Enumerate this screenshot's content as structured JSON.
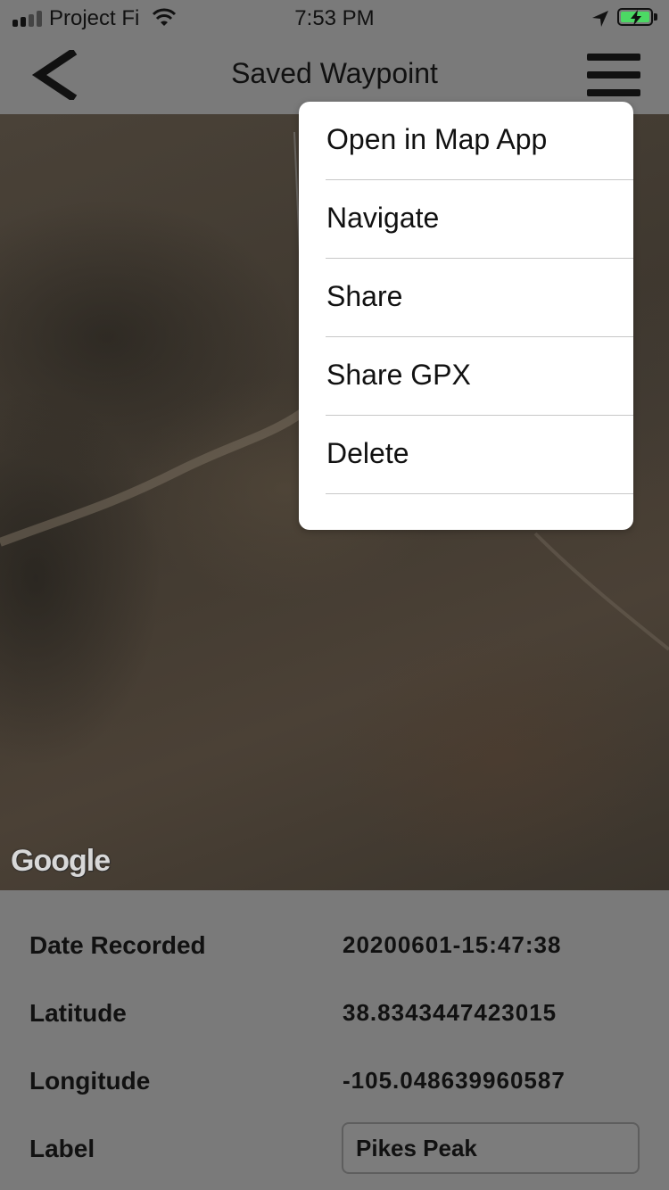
{
  "status_bar": {
    "carrier": "Project Fi",
    "time": "7:53 PM",
    "battery_color": "#4cd964"
  },
  "nav": {
    "title": "Saved Waypoint",
    "back_icon": "chevron-left-icon",
    "menu_icon": "hamburger-menu-icon"
  },
  "map": {
    "attribution": "Google",
    "type": "satellite"
  },
  "menu": {
    "items": [
      {
        "label": "Open in Map App"
      },
      {
        "label": "Navigate"
      },
      {
        "label": "Share"
      },
      {
        "label": "Share GPX"
      },
      {
        "label": "Delete"
      }
    ]
  },
  "details": {
    "date_label": "Date Recorded",
    "date_value": "20200601-15:47:38",
    "latitude_label": "Latitude",
    "latitude_value": "38.8343447423015",
    "longitude_label": "Longitude",
    "longitude_value": "-105.048639960587",
    "label_label": "Label",
    "label_value": "Pikes Peak"
  }
}
